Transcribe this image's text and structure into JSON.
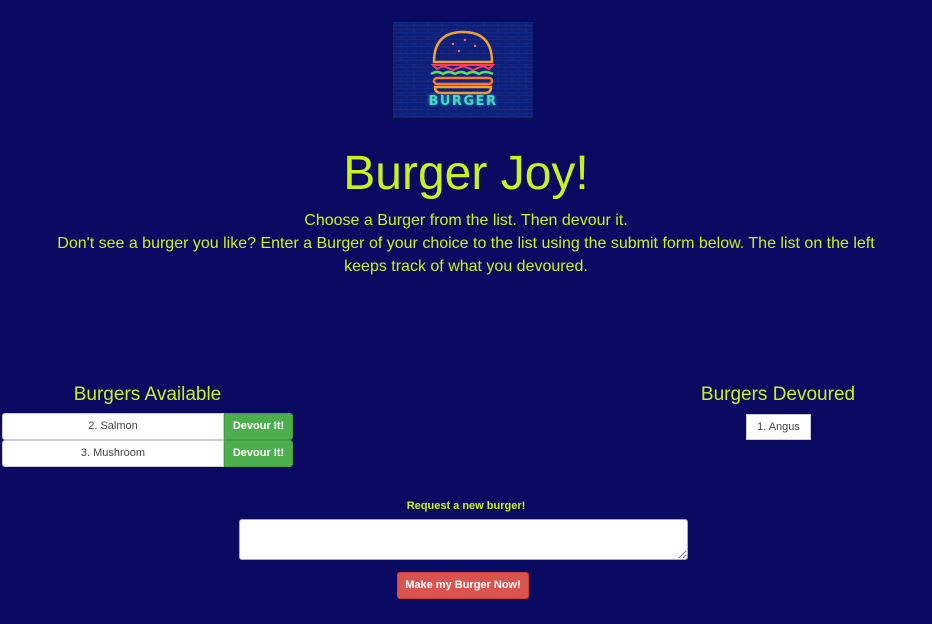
{
  "logo": {
    "icon": "burger-neon-icon",
    "text": "BURGER"
  },
  "title": "Burger Joy!",
  "description": {
    "line1": "Choose a Burger from the list. Then devour it.",
    "line2": "Don't see a burger you like? Enter a Burger of your choice to the list using the submit form below. The list on the left keeps track of what you devoured."
  },
  "available": {
    "heading": "Burgers Available",
    "items": [
      {
        "name": "2. Salmon",
        "button": "Devour It!"
      },
      {
        "name": "3. Mushroom",
        "button": "Devour It!"
      }
    ]
  },
  "devoured": {
    "heading": "Burgers Devoured",
    "items": [
      {
        "name": "1. Angus"
      }
    ]
  },
  "request": {
    "label": "Request a new burger!",
    "value": "",
    "submit": "Make my Burger Now!"
  },
  "colors": {
    "background": "#0a0a63",
    "accent": "#c7f21c",
    "devour_button": "#4cae4c",
    "submit_button": "#d9534f"
  }
}
